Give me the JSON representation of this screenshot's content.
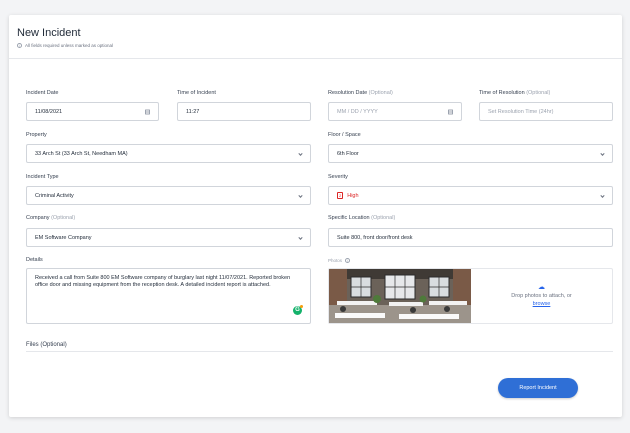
{
  "header": {
    "title": "New Incident",
    "subtitle": "All fields required unless marked as optional"
  },
  "optional_marker": "(Optional)",
  "fields": {
    "incident_date": {
      "label": "Incident Date",
      "value": "11/08/2021"
    },
    "time_of_incident": {
      "label": "Time of Incident",
      "value": "11:27"
    },
    "resolution_date": {
      "label": "Resolution Date",
      "placeholder": "MM / DD / YYYY"
    },
    "time_of_resolution": {
      "label": "Time of Resolution",
      "placeholder": "Set Resolution Time (24hr)"
    },
    "property": {
      "label": "Property",
      "value": "33 Arch St (33 Arch St, Needham MA)"
    },
    "floor_space": {
      "label": "Floor / Space",
      "value": "6th Floor"
    },
    "incident_type": {
      "label": "Incident Type",
      "value": "Criminal Activity"
    },
    "severity": {
      "label": "Severity",
      "badge": "2",
      "value": "High",
      "color": "#dc2626"
    },
    "company": {
      "label": "Company",
      "value": "EM Software Company"
    },
    "specific_location": {
      "label": "Specific Location",
      "value": "Suite 800, front door/front desk"
    },
    "details": {
      "label": "Details",
      "value": "Received a call from Suite 800 EM Software company of burglary last night 11/07/2021. Reported broken office door and missing equipment from the reception desk. A detailed incident report is attached."
    },
    "photos": {
      "label": "Photos",
      "drop_text": "Drop photos to attach, or",
      "browse_label": "browse"
    },
    "files": {
      "label": "Files"
    }
  },
  "actions": {
    "submit_label": "Report Incident",
    "accent": "#2f6fd6"
  }
}
